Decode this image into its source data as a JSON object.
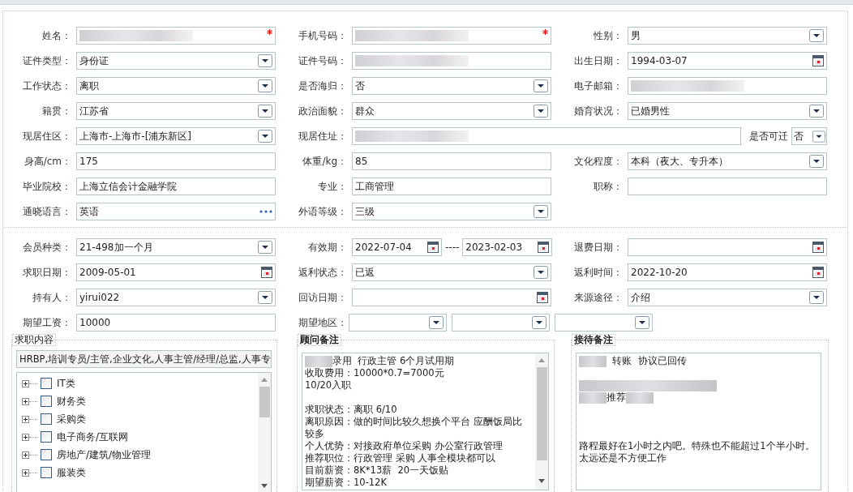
{
  "personal": [
    {
      "label": "姓名：",
      "kind": "text",
      "redacted": true,
      "required": true
    },
    {
      "label": "手机号码：",
      "kind": "text",
      "redacted": true,
      "required": true
    },
    {
      "label": "性别：",
      "kind": "select",
      "value": "男"
    },
    {
      "label": "证件类型：",
      "kind": "select",
      "value": "身份证"
    },
    {
      "label": "证件号码：",
      "kind": "text",
      "redacted": true
    },
    {
      "label": "出生日期：",
      "kind": "date",
      "value": "1994-03-07"
    },
    {
      "label": "工作状态：",
      "kind": "select",
      "value": "离职"
    },
    {
      "label": "是否海归：",
      "kind": "select",
      "value": "否"
    },
    {
      "label": "电子邮箱：",
      "kind": "text",
      "redacted": true
    },
    {
      "label": "籍贯：",
      "kind": "select",
      "value": "江苏省"
    },
    {
      "label": "政治面貌：",
      "kind": "select",
      "value": "群众"
    },
    {
      "label": "婚育状况：",
      "kind": "select",
      "value": "已婚男性"
    },
    {
      "label": "现居住区：",
      "kind": "select",
      "value": "上海市-上海市-[浦东新区]"
    },
    {
      "label": "现居住址：",
      "kind": "text",
      "redacted": true,
      "extra": {
        "label": "是否可迁",
        "kind": "select",
        "value": "否"
      }
    },
    {
      "label": "身高/cm：",
      "kind": "text",
      "value": "175"
    },
    {
      "label": "体重/kg：",
      "kind": "text",
      "value": "85"
    },
    {
      "label": "文化程度：",
      "kind": "select",
      "value": "本科（夜大、专升本）"
    },
    {
      "label": "毕业院校：",
      "kind": "text",
      "value": "上海立信会计金融学院"
    },
    {
      "label": "专业：",
      "kind": "text",
      "value": "工商管理"
    },
    {
      "label": "职称：",
      "kind": "text"
    },
    {
      "label": "通晓语言：",
      "kind": "lookup",
      "value": "英语"
    },
    {
      "label": "外语等级：",
      "kind": "select",
      "value": "三级"
    }
  ],
  "membership": [
    {
      "label": "会员种类：",
      "kind": "select",
      "value": "21-498加一个月"
    },
    {
      "label": "有效期：",
      "kind": "date_range",
      "value": "2022-07-04",
      "separator": "----",
      "value_end": "2023-02-03"
    },
    {
      "label": "退费日期：",
      "kind": "date"
    },
    {
      "label": "求职日期：",
      "kind": "date",
      "value": "2009-05-01"
    },
    {
      "label": "返利状态：",
      "kind": "select",
      "value": "已返"
    },
    {
      "label": "返利时间：",
      "kind": "date",
      "value": "2022-10-20"
    },
    {
      "label": "持有人：",
      "kind": "select",
      "value": "yirui022"
    },
    {
      "label": "回访日期：",
      "kind": "date"
    },
    {
      "label": "来源途径：",
      "kind": "select",
      "value": "介绍"
    },
    {
      "label": "期望工资：",
      "kind": "text",
      "value": "10000"
    },
    {
      "label": "期望地区：",
      "kind": "region_select"
    }
  ],
  "groups": [
    {
      "kind": "category_tree",
      "title": "求职内容",
      "emphasis": false,
      "summary": "HRBP,培训专员/主管,企业文化,人事主管/经理/总监,人事专",
      "items": [
        {
          "label": "IT类",
          "checked": false,
          "expanded": false
        },
        {
          "label": "财务类",
          "checked": false,
          "expanded": false
        },
        {
          "label": "采购类",
          "checked": false,
          "expanded": false
        },
        {
          "label": "电子商务/互联网",
          "checked": false,
          "expanded": false
        },
        {
          "label": "房地产/建筑/物业管理",
          "checked": false,
          "expanded": false
        },
        {
          "label": "服装类",
          "checked": false,
          "expanded": false
        }
      ]
    },
    {
      "kind": "notes",
      "title": "顾问备注",
      "emphasis": true,
      "scrollable": true,
      "lines": [
        {
          "kind": "content",
          "parts": [
            {
              "kind": "blur"
            },
            {
              "kind": "text",
              "text": "录用  行政主管 6个月试用期"
            }
          ]
        },
        {
          "kind": "content",
          "parts": [
            {
              "kind": "text",
              "text": "收取费用：10000*0.7=7000元"
            }
          ]
        },
        {
          "kind": "content",
          "parts": [
            {
              "kind": "text",
              "text": "10/20入职"
            }
          ]
        },
        {
          "kind": "blank"
        },
        {
          "kind": "content",
          "parts": [
            {
              "kind": "text",
              "text": "求职状态：离职 6/10"
            }
          ]
        },
        {
          "kind": "content",
          "parts": [
            {
              "kind": "text",
              "text": "离职原因：做的时间比较久想换个平台 应酬饭局比"
            }
          ]
        },
        {
          "kind": "content",
          "parts": [
            {
              "kind": "text",
              "text": "较多"
            }
          ]
        },
        {
          "kind": "content",
          "parts": [
            {
              "kind": "text",
              "text": "个人优势：对接政府单位采购 办公室行政管理"
            }
          ]
        },
        {
          "kind": "content",
          "parts": [
            {
              "kind": "text",
              "text": "推荐职位：行政管理 采购 人事全模块都可以"
            }
          ]
        },
        {
          "kind": "content",
          "parts": [
            {
              "kind": "text",
              "text": "目前薪资：8K*13薪  20一天饭贴"
            }
          ]
        },
        {
          "kind": "content",
          "parts": [
            {
              "kind": "text",
              "text": "期望薪资：10-12K"
            }
          ]
        }
      ]
    },
    {
      "kind": "notes",
      "title": "接待备注",
      "emphasis": true,
      "scrollable": false,
      "lines": [
        {
          "kind": "content",
          "parts": [
            {
              "kind": "blur"
            },
            {
              "kind": "text",
              "text": "  转账  协议已回传"
            }
          ]
        },
        {
          "kind": "blank"
        },
        {
          "kind": "content",
          "parts": [
            {
              "kind": "blur_wide"
            }
          ]
        },
        {
          "kind": "content",
          "parts": [
            {
              "kind": "blur"
            },
            {
              "kind": "text",
              "text": "推荐"
            },
            {
              "kind": "blur"
            }
          ]
        },
        {
          "kind": "blank"
        },
        {
          "kind": "blank"
        },
        {
          "kind": "blank"
        },
        {
          "kind": "content",
          "parts": [
            {
              "kind": "text",
              "text": "路程最好在1小时之内吧。特殊也不能超过1个半小时。"
            }
          ]
        },
        {
          "kind": "content",
          "parts": [
            {
              "kind": "text",
              "text": "太远还是不方便工作"
            }
          ]
        }
      ]
    }
  ]
}
